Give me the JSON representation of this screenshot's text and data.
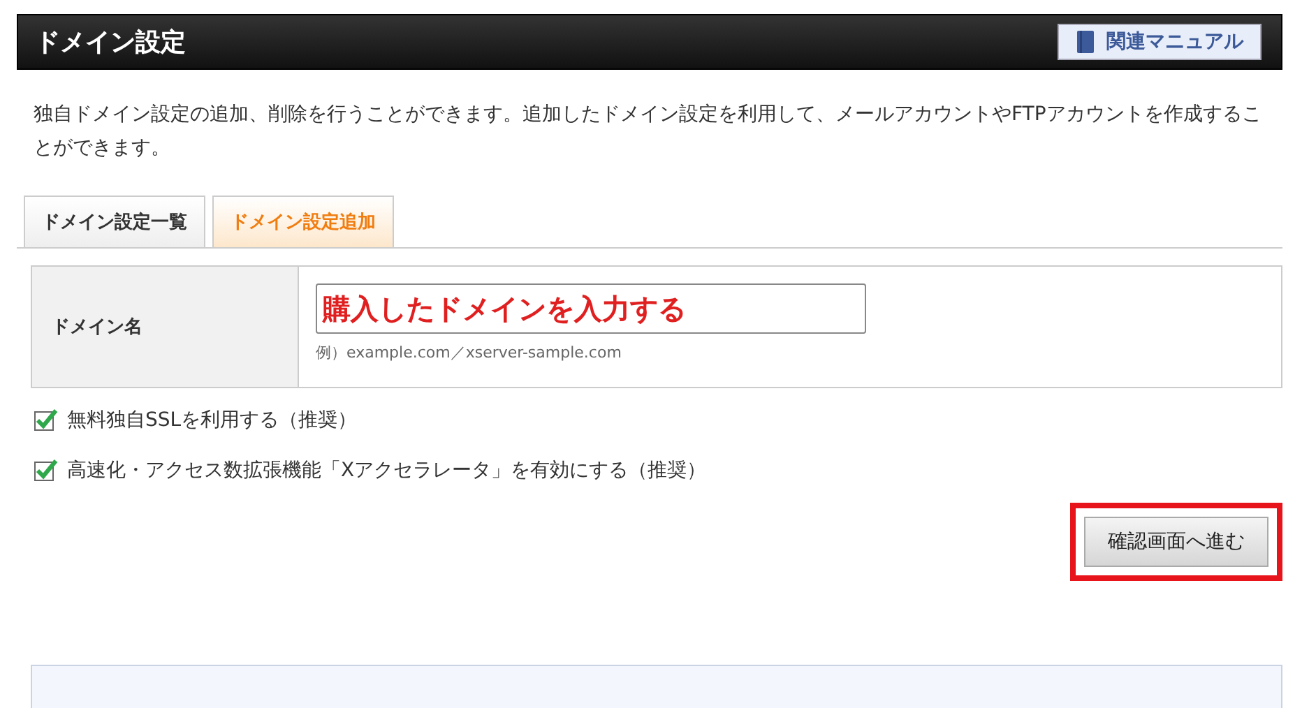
{
  "header": {
    "title": "ドメイン設定",
    "manual_button": "関連マニュアル"
  },
  "description": "独自ドメイン設定の追加、削除を行うことができます。追加したドメイン設定を利用して、メールアカウントやFTPアカウントを作成することができます。",
  "tabs": [
    {
      "label": "ドメイン設定一覧",
      "selected": false
    },
    {
      "label": "ドメイン設定追加",
      "selected": true
    }
  ],
  "form": {
    "label": "ドメイン名",
    "value": "購入したドメインを入力する",
    "hint": "例）example.com／xserver-sample.com"
  },
  "options": [
    {
      "label": "無料独自SSLを利用する（推奨）",
      "checked": true
    },
    {
      "label": "高速化・アクセス数拡張機能「Xアクセラレータ」を有効にする（推奨）",
      "checked": true
    }
  ],
  "submit": {
    "label": "確認画面へ進む",
    "highlighted": true
  }
}
